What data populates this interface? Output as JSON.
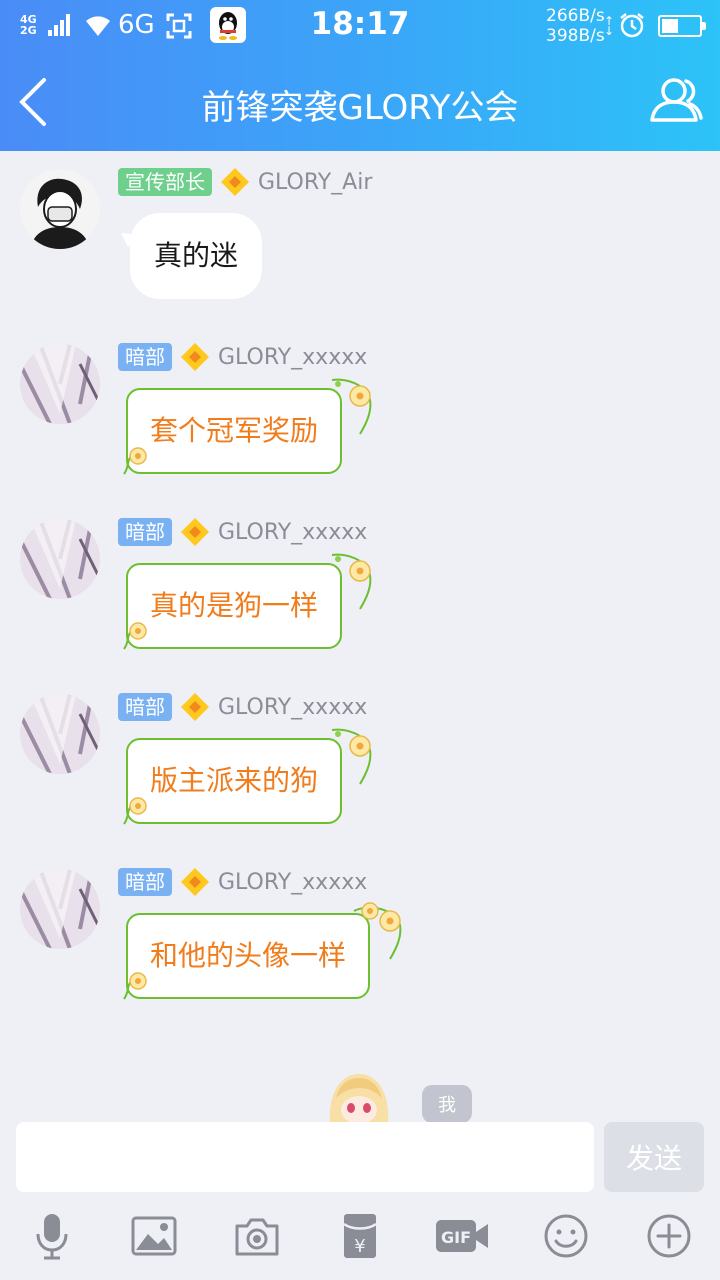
{
  "status_bar": {
    "network_top": "4G",
    "network_bottom": "2G",
    "network_type": "6G",
    "time": "18:17",
    "speed_up": "266B/s",
    "speed_down": "398B/s"
  },
  "header": {
    "title": "前锋突袭GLORY公会"
  },
  "messages": [
    {
      "role": "宣传部长",
      "role_color": "#6fd08e",
      "nickname": "GLORY_Air",
      "text": "真的迷",
      "bubble": "plain",
      "avatar": "masked-person"
    },
    {
      "role": "暗部",
      "role_color": "#7ab1f3",
      "nickname": "GLORY_xxxxx",
      "text": "套个冠军奖励",
      "bubble": "vine",
      "avatar": "anime-figure"
    },
    {
      "role": "暗部",
      "role_color": "#7ab1f3",
      "nickname": "GLORY_xxxxx",
      "text": "真的是狗一样",
      "bubble": "vine",
      "avatar": "anime-figure"
    },
    {
      "role": "暗部",
      "role_color": "#7ab1f3",
      "nickname": "GLORY_xxxxx",
      "text": "版主派来的狗",
      "bubble": "vine",
      "avatar": "anime-figure"
    },
    {
      "role": "暗部",
      "role_color": "#7ab1f3",
      "nickname": "GLORY_xxxxx",
      "text": "和他的头像一样",
      "bubble": "vine",
      "avatar": "anime-figure"
    }
  ],
  "me_tag": "我",
  "composer": {
    "input_value": "",
    "send_label": "发送"
  },
  "toolbar_icons": [
    "microphone-icon",
    "image-icon",
    "camera-icon",
    "red-packet-icon",
    "gif-icon",
    "emoji-icon",
    "plus-icon"
  ],
  "colors": {
    "header_start": "#4a8cf7",
    "header_end": "#2cc3f8",
    "vine_text": "#f07c1c",
    "vine_border": "#6cbf2e",
    "background": "#eef0f6"
  }
}
